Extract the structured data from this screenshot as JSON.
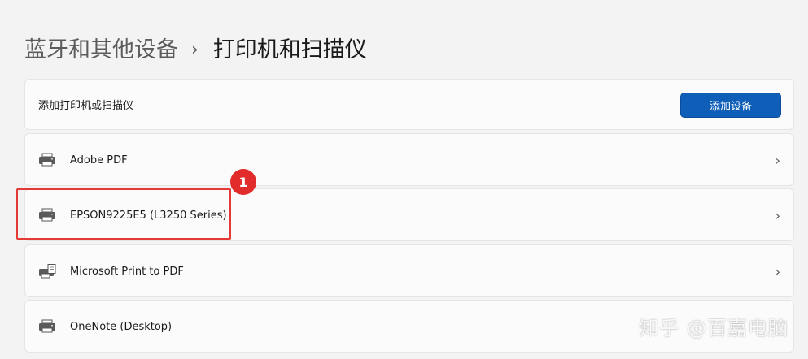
{
  "breadcrumb": {
    "parent": "蓝牙和其他设备",
    "separator": "›",
    "current": "打印机和扫描仪"
  },
  "add_device": {
    "label": "添加打印机或扫描仪",
    "button": "添加设备"
  },
  "printers": [
    {
      "name": "Adobe PDF",
      "icon": "printer-icon"
    },
    {
      "name": "EPSON9225E5 (L3250 Series)",
      "icon": "printer-icon"
    },
    {
      "name": "Microsoft Print to PDF",
      "icon": "printer-document-icon"
    },
    {
      "name": "OneNote (Desktop)",
      "icon": "printer-icon"
    }
  ],
  "chevron": "›",
  "annotation": {
    "step": "1",
    "color": "#e53935"
  },
  "watermark": "知乎 @百嘉电脑",
  "colors": {
    "accent": "#0f5fb9",
    "background": "#f3f3f3",
    "card": "#fbfbfb"
  }
}
